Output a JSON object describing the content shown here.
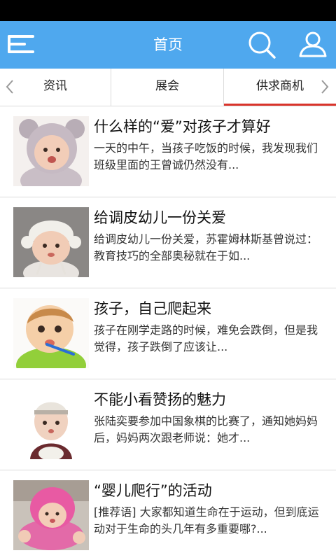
{
  "header": {
    "title": "首页",
    "menu_icon": "hamburger-menu-icon",
    "search_icon": "search-icon",
    "user_icon": "user-icon",
    "bg_color": "#4fa8ee"
  },
  "tabs": {
    "items": [
      {
        "label": "资讯"
      },
      {
        "label": "展会"
      },
      {
        "label": "供求商机"
      }
    ],
    "active_index": 2,
    "active_color": "#d9342b"
  },
  "articles": [
    {
      "title": "什么样的“爱”对孩子才算好",
      "desc": "一天的中午，当孩子吃饭的时候，我发现我们班级里面的王曾诚仍然没有..."
    },
    {
      "title": "给调皮幼儿一份关爱",
      "desc": "给调皮幼儿一份关爱，苏霍姆林斯基曾说过：教育技巧的全部奥秘就在于如..."
    },
    {
      "title": "孩子，自己爬起来",
      "desc": "孩子在刚学走路的时候，难免会跌倒，但是我觉得，孩子跌倒了应该让..."
    },
    {
      "title": "不能小看赞扬的魅力",
      "desc": "张陆奕要参加中国象棋的比赛了，通知她妈妈后，妈妈两次跟老师说：她才..."
    },
    {
      "title": "“婴儿爬行”的活动",
      "desc": "[推荐语] 大家都知道生命在于运动，但到底运动对于生命的头几年有多重要哪?..."
    }
  ]
}
